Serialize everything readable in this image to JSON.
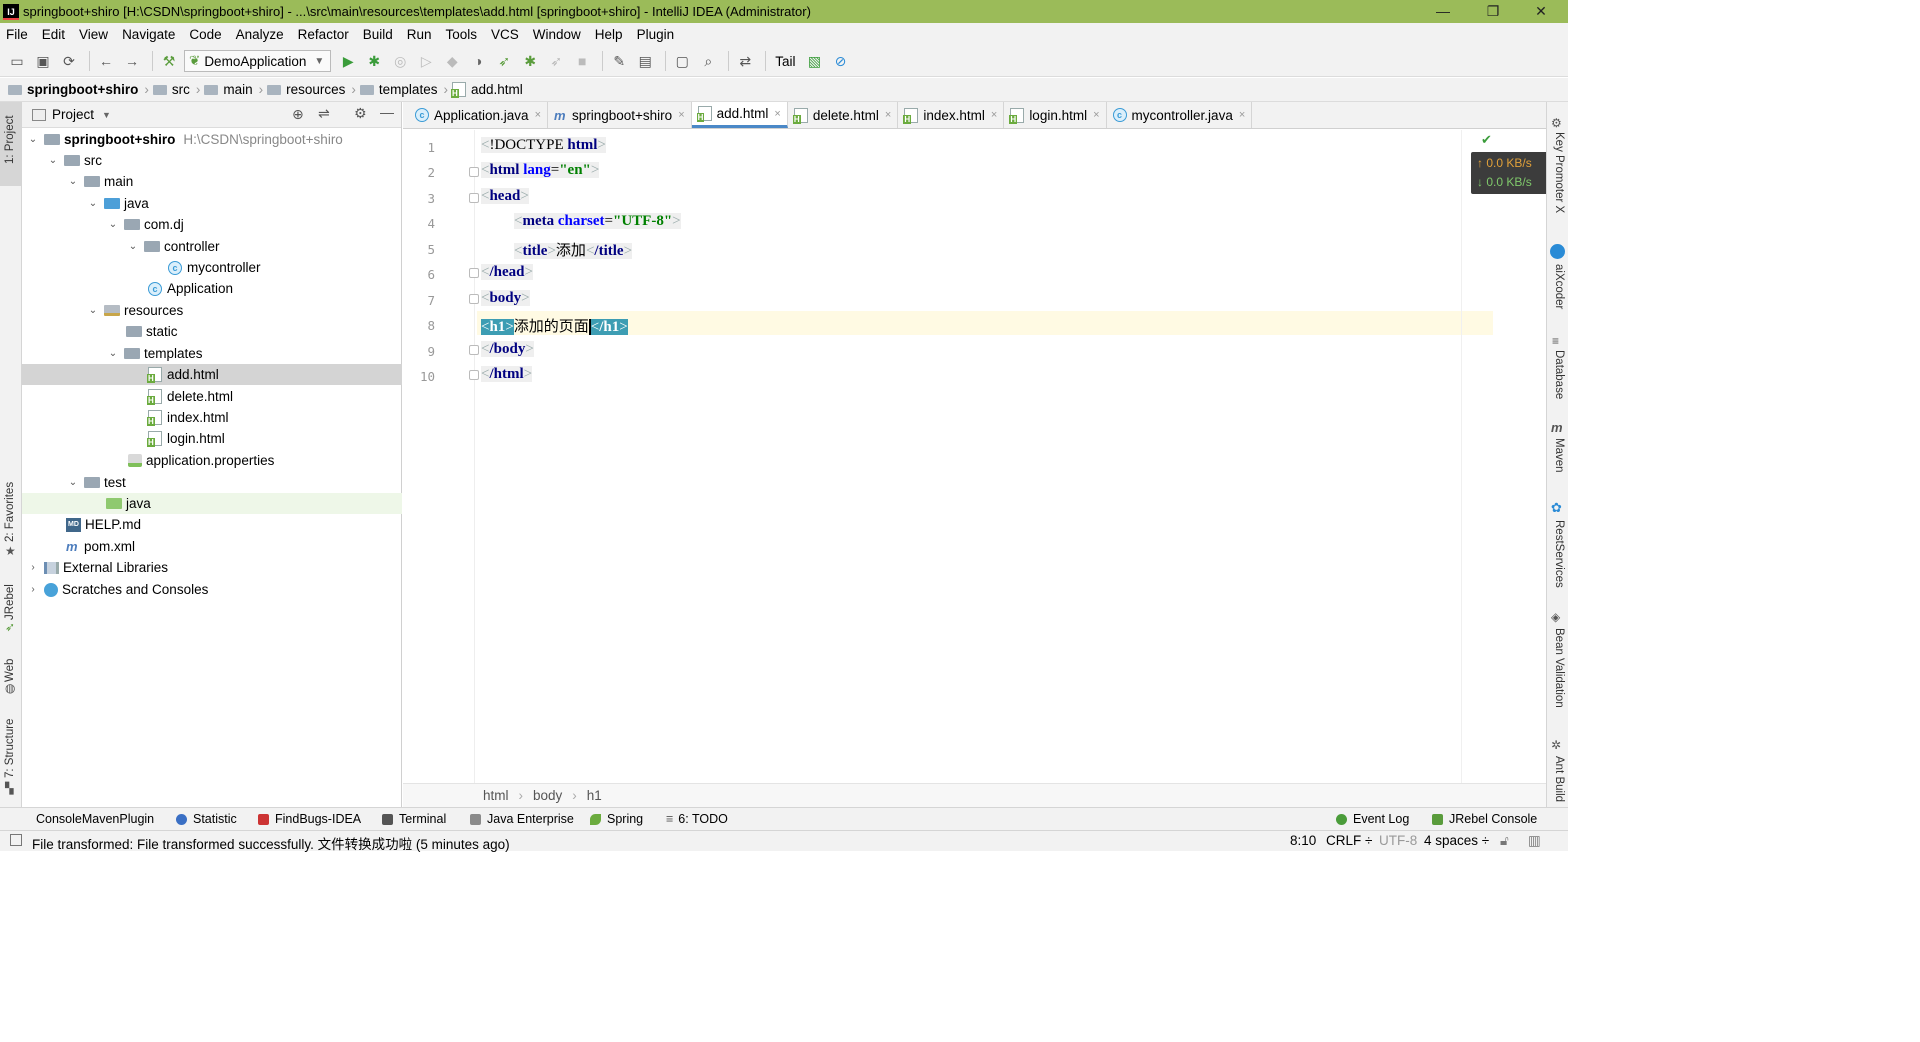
{
  "window": {
    "title": "springboot+shiro [H:\\CSDN\\springboot+shiro] - ...\\src\\main\\resources\\templates\\add.html [springboot+shiro] - IntelliJ IDEA (Administrator)",
    "minimize": "—",
    "restore": "❐",
    "close": "✕"
  },
  "menu": [
    "File",
    "Edit",
    "View",
    "Navigate",
    "Code",
    "Analyze",
    "Refactor",
    "Build",
    "Run",
    "Tools",
    "VCS",
    "Window",
    "Help",
    "Plugin"
  ],
  "toolbar": {
    "run_config": "DemoApplication",
    "tail_label": "Tail"
  },
  "navbar": {
    "crumbs": [
      "springboot+shiro",
      "src",
      "main",
      "resources",
      "templates",
      "add.html"
    ]
  },
  "left_strip": {
    "project": "1: Project",
    "favorites": "2: Favorites",
    "jrebel": "JRebel",
    "web": "Web",
    "structure": "7: Structure"
  },
  "right_strip": {
    "key_promoter": "Key Promoter X",
    "aixcoder": "aiXcoder",
    "database": "Database",
    "maven": "Maven",
    "restservices": "RestServices",
    "bean_validation": "Bean Validation",
    "ant_build": "Ant Build"
  },
  "project_panel": {
    "title": "Project",
    "tree": [
      {
        "label": "springboot+shiro",
        "path": "H:\\CSDN\\springboot+shiro",
        "bold": true
      },
      {
        "label": "src"
      },
      {
        "label": "main"
      },
      {
        "label": "java"
      },
      {
        "label": "com.dj"
      },
      {
        "label": "controller"
      },
      {
        "label": "mycontroller"
      },
      {
        "label": "Application"
      },
      {
        "label": "resources"
      },
      {
        "label": "static"
      },
      {
        "label": "templates"
      },
      {
        "label": "add.html"
      },
      {
        "label": "delete.html"
      },
      {
        "label": "index.html"
      },
      {
        "label": "login.html"
      },
      {
        "label": "application.properties"
      },
      {
        "label": "test"
      },
      {
        "label": "java"
      },
      {
        "label": "HELP.md"
      },
      {
        "label": "pom.xml"
      },
      {
        "label": "External Libraries"
      },
      {
        "label": "Scratches and Consoles"
      }
    ]
  },
  "tabs": [
    {
      "label": "Application.java",
      "close": "×"
    },
    {
      "label": "springboot+shiro",
      "close": "×"
    },
    {
      "label": "add.html",
      "close": "×",
      "active": true
    },
    {
      "label": "delete.html",
      "close": "×"
    },
    {
      "label": "index.html",
      "close": "×"
    },
    {
      "label": "login.html",
      "close": "×"
    },
    {
      "label": "mycontroller.java",
      "close": "×"
    }
  ],
  "editor": {
    "line_numbers": [
      "1",
      "2",
      "3",
      "4",
      "5",
      "6",
      "7",
      "8",
      "9",
      "10"
    ],
    "lines": [
      {
        "doctype": "!DOCTYPE",
        "html": "html"
      },
      {
        "tag": "html",
        "attr": "lang",
        "val": "\"en\""
      },
      {
        "tag": "head"
      },
      {
        "tag": "meta",
        "attr": "charset",
        "val": "\"UTF-8\""
      },
      {
        "open": "title",
        "text": "添加",
        "close": "/title"
      },
      {
        "tag": "/head"
      },
      {
        "tag": "body"
      },
      {
        "open": "h1",
        "text": "添加的页面",
        "close": "/h1"
      },
      {
        "tag": "/body"
      },
      {
        "tag": "/html"
      }
    ],
    "net_up": "↑ 0.0 KB/s",
    "net_down": "↓ 0.0 KB/s"
  },
  "breadcrumb": [
    "html",
    "body",
    "h1"
  ],
  "tool_windows": {
    "console_maven": "ConsoleMavenPlugin",
    "statistic": "Statistic",
    "findbugs": "FindBugs-IDEA",
    "terminal": "Terminal",
    "java_enterprise": "Java Enterprise",
    "spring": "Spring",
    "todo": "6: TODO",
    "event_log": "Event Log",
    "jrebel_console": "JRebel Console"
  },
  "status": {
    "message": "File transformed: File transformed successfully. 文件转换成功啦 (5 minutes ago)",
    "position": "8:10",
    "line_sep": "CRLF ÷",
    "encoding": "UTF-8",
    "indent": "4 spaces ÷"
  }
}
